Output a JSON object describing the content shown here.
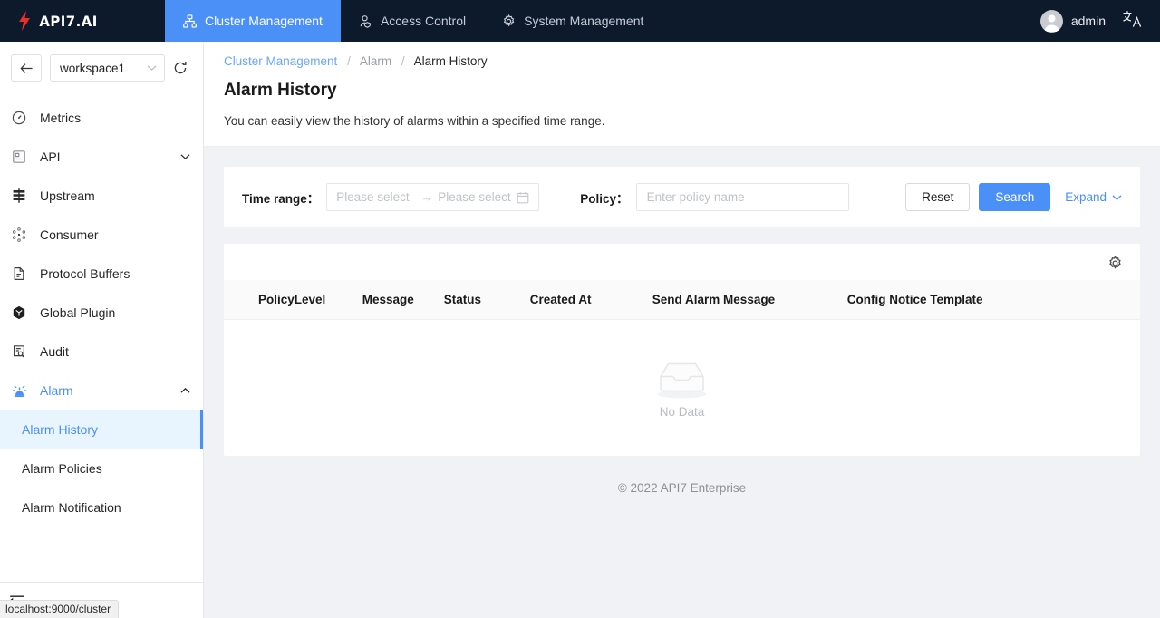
{
  "topnav": {
    "logo_text": "API7.AI",
    "logo_icon": "lightning-bolt-icon",
    "items": [
      {
        "label": "Cluster Management",
        "icon": "sitemap-icon",
        "active": true
      },
      {
        "label": "Access Control",
        "icon": "user-shield-icon",
        "active": false
      },
      {
        "label": "System Management",
        "icon": "gear-icon",
        "active": false
      }
    ],
    "user": {
      "name": "admin",
      "avatar_icon": "user-avatar-icon"
    },
    "language_icon": "translate-icon"
  },
  "sidebar": {
    "back_icon": "arrow-left-icon",
    "workspace": {
      "value": "workspace1",
      "caret_icon": "chevron-down-icon"
    },
    "refresh_icon": "refresh-icon",
    "collapse_icon": "menu-fold-icon",
    "items": [
      {
        "label": "Metrics",
        "icon": "gauge-icon"
      },
      {
        "label": "API",
        "icon": "api-card-icon",
        "expandable": true
      },
      {
        "label": "Upstream",
        "icon": "server-stack-icon"
      },
      {
        "label": "Consumer",
        "icon": "consumer-nodes-icon"
      },
      {
        "label": "Protocol Buffers",
        "icon": "document-icon"
      },
      {
        "label": "Global Plugin",
        "icon": "cube-icon"
      },
      {
        "label": "Audit",
        "icon": "document-search-icon"
      },
      {
        "label": "Alarm",
        "icon": "alarm-light-icon",
        "expandable": true,
        "expanded": true
      }
    ],
    "alarm_submenu": [
      {
        "label": "Alarm History",
        "active": true
      },
      {
        "label": "Alarm Policies",
        "active": false
      },
      {
        "label": "Alarm Notification",
        "active": false
      }
    ]
  },
  "breadcrumb": {
    "root": "Cluster Management",
    "middle": "Alarm",
    "current": "Alarm History",
    "separator": "/"
  },
  "page": {
    "title": "Alarm History",
    "description": "You can easily view the history of alarms within a specified time range."
  },
  "filters": {
    "time_range_label": "Time range：",
    "time_range_start_placeholder": "Please select",
    "time_range_end_placeholder": "Please select",
    "range_arrow": "→",
    "calendar_icon": "calendar-icon",
    "policy_label": "Policy：",
    "policy_placeholder": "Enter policy name",
    "policy_value": "",
    "reset_label": "Reset",
    "search_label": "Search",
    "expand_label": "Expand",
    "expand_icon": "chevron-down-icon"
  },
  "table": {
    "settings_icon": "gear-icon",
    "columns": [
      "Policy",
      "Level",
      "Message",
      "Status",
      "Created At",
      "Send Alarm Message",
      "Config Notice Template"
    ],
    "rows": [],
    "empty_text": "No Data",
    "empty_icon": "empty-inbox-icon"
  },
  "footer": {
    "text": "© 2022 API7 Enterprise"
  },
  "statusbar": {
    "url": "localhost:9000/cluster"
  },
  "colors": {
    "nav_bg": "#0d1a2b",
    "accent": "#4a90f7",
    "active_submenu_bg": "#e8f4fe",
    "content_bg": "#f0f2f5",
    "logo_bolt": "#e8312a"
  }
}
